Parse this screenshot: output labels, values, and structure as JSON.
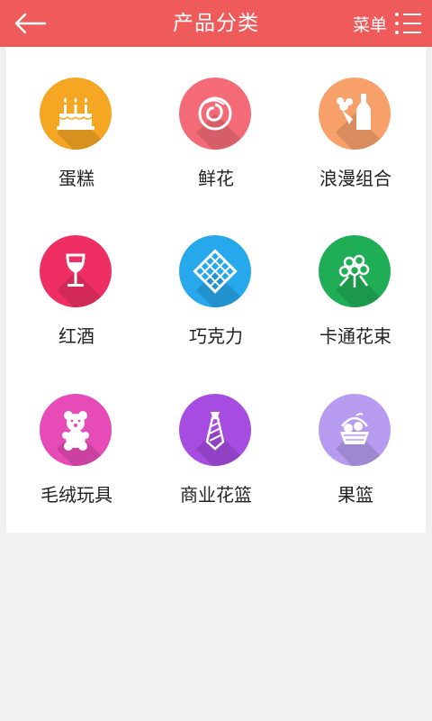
{
  "header": {
    "title": "产品分类",
    "menu_label": "菜单",
    "bg_color": "#ef5a5a"
  },
  "categories": [
    {
      "label": "蛋糕",
      "icon": "cake-icon",
      "color": "#f5a623"
    },
    {
      "label": "鲜花",
      "icon": "rose-icon",
      "color": "#f46b77"
    },
    {
      "label": "浪漫组合",
      "icon": "flowers-wine-icon",
      "color": "#f7a06a"
    },
    {
      "label": "红酒",
      "icon": "wine-glass-icon",
      "color": "#ef2f64"
    },
    {
      "label": "巧克力",
      "icon": "chocolate-icon",
      "color": "#27a7ec"
    },
    {
      "label": "卡通花束",
      "icon": "bouquet-icon",
      "color": "#1fae56"
    },
    {
      "label": "毛绒玩具",
      "icon": "teddy-bear-icon",
      "color": "#e64bb8"
    },
    {
      "label": "商业花篮",
      "icon": "tie-icon",
      "color": "#a64ce0"
    },
    {
      "label": "果篮",
      "icon": "fruit-basket-icon",
      "color": "#b69bf0"
    }
  ]
}
